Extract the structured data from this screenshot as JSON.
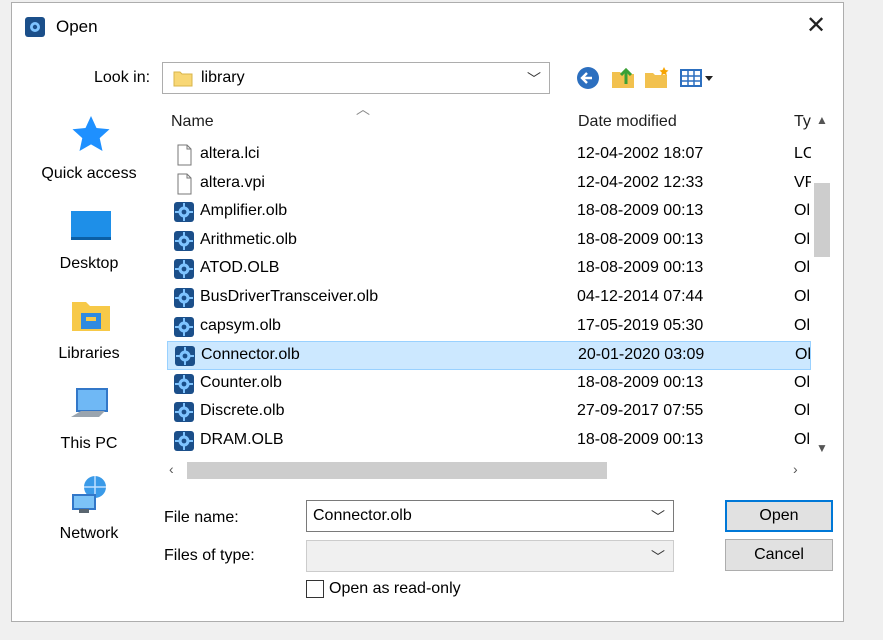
{
  "window": {
    "title": "Open",
    "close_icon": "close-icon"
  },
  "lookin": {
    "label": "Look in:",
    "value": "library"
  },
  "places": [
    {
      "label": "Quick access",
      "icon": "quick-access-star-icon"
    },
    {
      "label": "Desktop",
      "icon": "desktop-icon"
    },
    {
      "label": "Libraries",
      "icon": "libraries-icon"
    },
    {
      "label": "This PC",
      "icon": "this-pc-icon"
    },
    {
      "label": "Network",
      "icon": "network-icon"
    }
  ],
  "columns": {
    "name": "Name",
    "date": "Date modified",
    "type": "Ty"
  },
  "files": [
    {
      "name": "altera.lci",
      "date": "12-04-2002 18:07",
      "type": "LC",
      "icon": "document-icon"
    },
    {
      "name": "altera.vpi",
      "date": "12-04-2002 12:33",
      "type": "VP",
      "icon": "document-icon"
    },
    {
      "name": "Amplifier.olb",
      "date": "18-08-2009 00:13",
      "type": "Ol",
      "icon": "olb-file-icon"
    },
    {
      "name": "Arithmetic.olb",
      "date": "18-08-2009 00:13",
      "type": "Ol",
      "icon": "olb-file-icon"
    },
    {
      "name": "ATOD.OLB",
      "date": "18-08-2009 00:13",
      "type": "Ol",
      "icon": "olb-file-icon"
    },
    {
      "name": "BusDriverTransceiver.olb",
      "date": "04-12-2014 07:44",
      "type": "Ol",
      "icon": "olb-file-icon"
    },
    {
      "name": "capsym.olb",
      "date": "17-05-2019 05:30",
      "type": "Ol",
      "icon": "olb-file-icon"
    },
    {
      "name": "Connector.olb",
      "date": "20-01-2020 03:09",
      "type": "Ol",
      "icon": "olb-file-icon",
      "selected": true
    },
    {
      "name": "Counter.olb",
      "date": "18-08-2009 00:13",
      "type": "Ol",
      "icon": "olb-file-icon"
    },
    {
      "name": "Discrete.olb",
      "date": "27-09-2017 07:55",
      "type": "Ol",
      "icon": "olb-file-icon"
    },
    {
      "name": "DRAM.OLB",
      "date": "18-08-2009 00:13",
      "type": "Ol",
      "icon": "olb-file-icon"
    }
  ],
  "filename": {
    "label": "File name:",
    "value": "Connector.olb"
  },
  "filetype": {
    "label": "Files of type:",
    "value": ""
  },
  "buttons": {
    "open": "Open",
    "cancel": "Cancel"
  },
  "readonly": {
    "label": "Open as read-only",
    "checked": false
  },
  "colors": {
    "selection": "#cce8ff",
    "accent": "#0078d7"
  }
}
